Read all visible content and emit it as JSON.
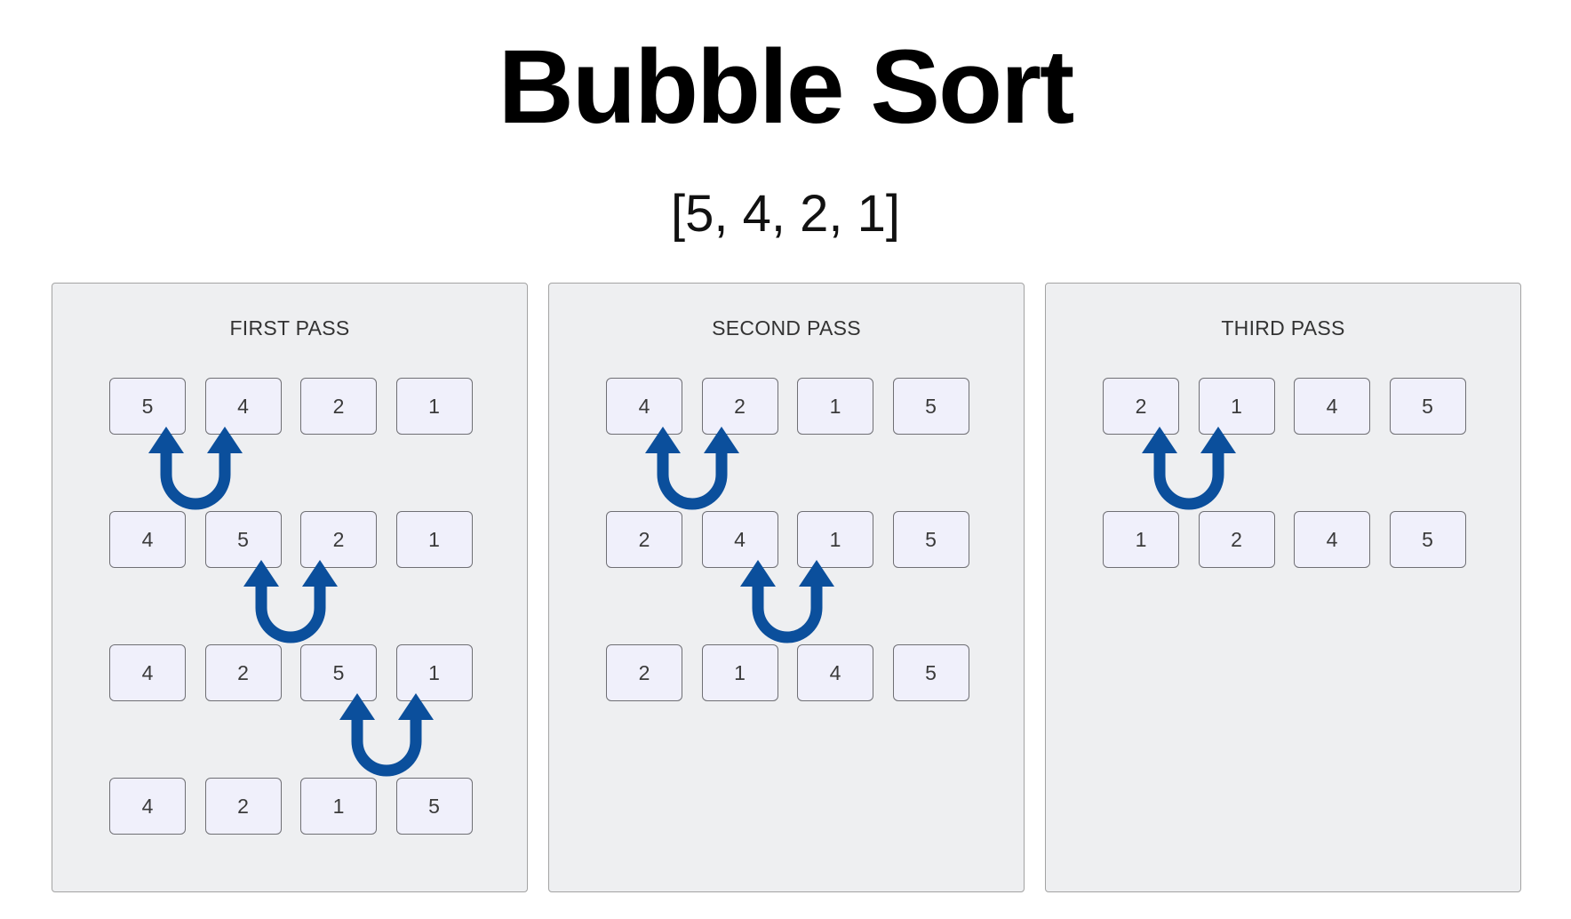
{
  "title": "Bubble Sort",
  "input_array": "[5, 4, 2, 1]",
  "colors": {
    "panel_background": "#eeeff1",
    "cell_background": "#f0f0fb",
    "arrow": "#0b4f9c"
  },
  "icons": {
    "swap": "u-turn-swap-arrow-icon"
  },
  "passes": [
    {
      "label": "FIRST PASS",
      "rows": [
        [
          "5",
          "4",
          "2",
          "1"
        ],
        [
          "4",
          "5",
          "2",
          "1"
        ],
        [
          "4",
          "2",
          "5",
          "1"
        ],
        [
          "4",
          "2",
          "1",
          "5"
        ]
      ],
      "swaps": [
        {
          "after_row": 0,
          "between": [
            0,
            1
          ]
        },
        {
          "after_row": 1,
          "between": [
            1,
            2
          ]
        },
        {
          "after_row": 2,
          "between": [
            2,
            3
          ]
        }
      ]
    },
    {
      "label": "SECOND PASS",
      "rows": [
        [
          "4",
          "2",
          "1",
          "5"
        ],
        [
          "2",
          "4",
          "1",
          "5"
        ],
        [
          "2",
          "1",
          "4",
          "5"
        ]
      ],
      "swaps": [
        {
          "after_row": 0,
          "between": [
            0,
            1
          ]
        },
        {
          "after_row": 1,
          "between": [
            1,
            2
          ]
        }
      ]
    },
    {
      "label": "THIRD PASS",
      "rows": [
        [
          "2",
          "1",
          "4",
          "5"
        ],
        [
          "1",
          "2",
          "4",
          "5"
        ]
      ],
      "swaps": [
        {
          "after_row": 0,
          "between": [
            0,
            1
          ]
        }
      ]
    }
  ]
}
